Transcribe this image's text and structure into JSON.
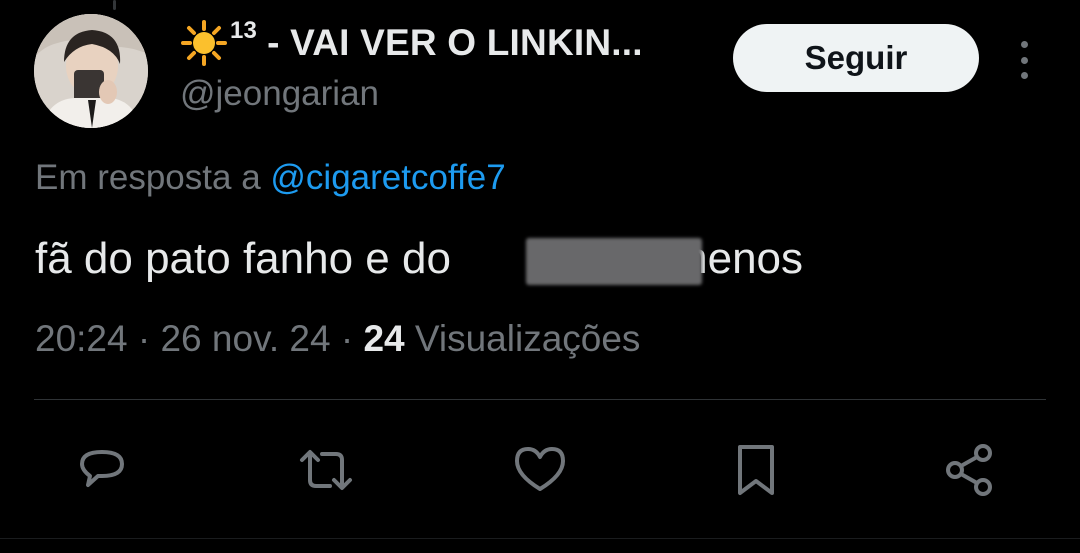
{
  "author": {
    "display_name_suffix": "13",
    "display_name_text": " - VAI VER O LINKIN...",
    "handle": "@jeongarian"
  },
  "follow_button": {
    "label": "Seguir"
  },
  "tweet": {
    "reply_prefix": "Em resposta a ",
    "reply_to": "@cigaretcoffe7",
    "text": "fã do pato fanho e do           mto menos",
    "time": "20:24",
    "separator": " · ",
    "date": "26 nov. 24",
    "views_count": "24",
    "views_label": " Visualizações"
  },
  "actions": [
    {
      "icon": "reply-icon"
    },
    {
      "icon": "retweet-icon"
    },
    {
      "icon": "like-icon"
    },
    {
      "icon": "bookmark-icon"
    },
    {
      "icon": "share-icon"
    }
  ],
  "colors": {
    "background": "#000000",
    "text_primary": "#e7e9ea",
    "text_secondary": "#71767b",
    "link": "#1d9bf0",
    "follow_button_bg": "#eff3f4",
    "divider": "#2f3336"
  }
}
